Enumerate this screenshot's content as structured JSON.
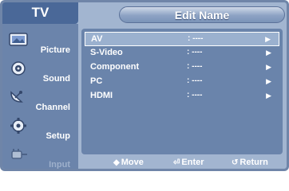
{
  "header": {
    "tv_label": "TV",
    "title": "Edit Name"
  },
  "sidebar": {
    "items": [
      {
        "label": "Picture",
        "icon": "picture-icon",
        "enabled": true
      },
      {
        "label": "Sound",
        "icon": "speaker-icon",
        "enabled": true
      },
      {
        "label": "Channel",
        "icon": "satellite-dish-icon",
        "enabled": true
      },
      {
        "label": "Setup",
        "icon": "gear-icon",
        "enabled": true
      },
      {
        "label": "Input",
        "icon": "plug-icon",
        "enabled": false
      }
    ]
  },
  "menu": {
    "rows": [
      {
        "label": "AV",
        "value": ": ----",
        "arrow": "▶",
        "selected": true
      },
      {
        "label": "S-Video",
        "value": ": ----",
        "arrow": "▶",
        "selected": false
      },
      {
        "label": "Component",
        "value": ": ----",
        "arrow": "▶",
        "selected": false
      },
      {
        "label": "PC",
        "value": ": ----",
        "arrow": "▶",
        "selected": false
      },
      {
        "label": "HDMI",
        "value": ": ----",
        "arrow": "▶",
        "selected": false
      }
    ]
  },
  "help": {
    "move": {
      "glyph": "◆",
      "label": "Move"
    },
    "enter": {
      "glyph": "⏎",
      "label": "Enter"
    },
    "return": {
      "glyph": "↺",
      "label": "Return"
    }
  },
  "colors": {
    "frame": "#6f85a8",
    "panel": "#6a84ab",
    "selected_row": "#9bb1cf",
    "sidebar": "#6b84ab",
    "tv_label_bg": "#4a6898"
  }
}
